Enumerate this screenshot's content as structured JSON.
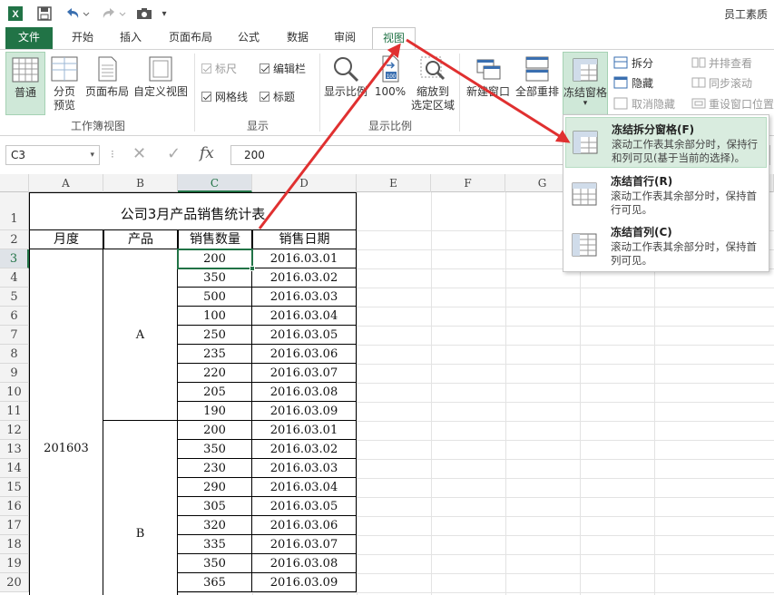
{
  "window": {
    "title_partial": "员工素质"
  },
  "quick_access": {
    "app_icon": "excel-icon",
    "save_icon": "save-icon",
    "undo_icon": "undo-icon",
    "redo_icon": "redo-icon",
    "camera_icon": "camera-icon",
    "more_icon": "customize-icon"
  },
  "tabs": [
    {
      "label": "文件"
    },
    {
      "label": "开始"
    },
    {
      "label": "插入"
    },
    {
      "label": "页面布局"
    },
    {
      "label": "公式"
    },
    {
      "label": "数据"
    },
    {
      "label": "审阅"
    },
    {
      "label": "视图"
    }
  ],
  "ribbon": {
    "workbook_views": {
      "label": "工作簿视图",
      "buttons": [
        "普通",
        "分页\n预览",
        "页面布局",
        "自定义视图"
      ]
    },
    "show": {
      "label": "显示",
      "options": [
        {
          "label": "标尺",
          "checked": true,
          "disabled": true
        },
        {
          "label": "编辑栏",
          "checked": true,
          "disabled": false
        },
        {
          "label": "网格线",
          "checked": true,
          "disabled": false
        },
        {
          "label": "标题",
          "checked": true,
          "disabled": false
        }
      ]
    },
    "zoom": {
      "label": "显示比例",
      "buttons": [
        "显示比例",
        "100%",
        "缩放到\n选定区域"
      ]
    },
    "window": {
      "buttons": [
        "新建窗口",
        "全部重排",
        "冻结窗格"
      ],
      "small": [
        "拆分",
        "隐藏",
        "取消隐藏"
      ],
      "small2": [
        "并排查看",
        "同步滚动",
        "重设窗口位置"
      ]
    }
  },
  "freeze_menu": [
    {
      "title": "冻结拆分窗格(F)",
      "desc": "滚动工作表其余部分时，保持行和列可见(基于当前的选择)。"
    },
    {
      "title": "冻结首行(R)",
      "desc": "滚动工作表其余部分时，保持首行可见。"
    },
    {
      "title": "冻结首列(C)",
      "desc": "滚动工作表其余部分时，保持首列可见。"
    }
  ],
  "formula_bar": {
    "name_box": "C3",
    "cancel": "✕",
    "enter": "✓",
    "fx": "fx",
    "value": "200"
  },
  "sheet": {
    "columns": [
      "A",
      "B",
      "C",
      "D",
      "E",
      "F",
      "G"
    ],
    "rows": [
      "1",
      "2",
      "3",
      "4",
      "5",
      "6",
      "7",
      "8",
      "9",
      "10",
      "11",
      "12",
      "13",
      "14",
      "15",
      "16",
      "17",
      "18",
      "19",
      "20"
    ],
    "title": "公司3月产品销售统计表",
    "headers": [
      "月度",
      "产品",
      "销售数量",
      "销售日期"
    ],
    "month": "201603",
    "product_a": "A",
    "product_b": "B",
    "quantities": [
      "200",
      "350",
      "500",
      "100",
      "250",
      "235",
      "220",
      "205",
      "190",
      "200",
      "350",
      "230",
      "290",
      "305",
      "320",
      "335",
      "350",
      "365"
    ],
    "dates": [
      "2016.03.01",
      "2016.03.02",
      "2016.03.03",
      "2016.03.04",
      "2016.03.05",
      "2016.03.06",
      "2016.03.07",
      "2016.03.08",
      "2016.03.09",
      "2016.03.01",
      "2016.03.02",
      "2016.03.03",
      "2016.03.04",
      "2016.03.05",
      "2016.03.06",
      "2016.03.07",
      "2016.03.08",
      "2016.03.09"
    ]
  },
  "colors": {
    "accent": "#217346",
    "arrow": "#e03030"
  }
}
